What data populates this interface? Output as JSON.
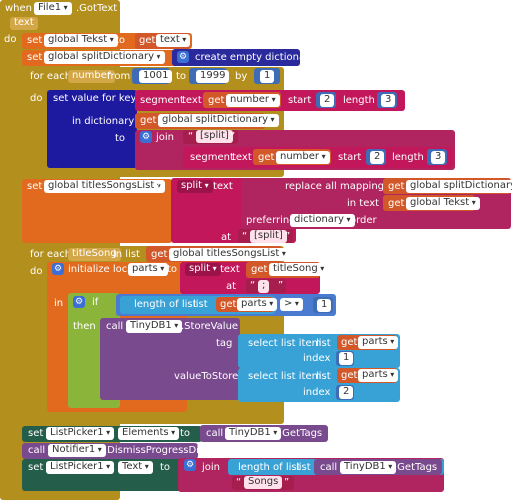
{
  "event": {
    "when": "when",
    "component": "File1",
    "event_name": ".GotText",
    "param": "text",
    "do": "do"
  },
  "set1": {
    "set": "set",
    "var": "global Tekst",
    "to": "to",
    "get": "get",
    "get_var": "text"
  },
  "set2": {
    "set": "set",
    "var": "global splitDictionary",
    "to": "to",
    "create": "create empty dictionary"
  },
  "foreach1": {
    "for_each": "for each",
    "var": "number",
    "from": "from",
    "from_val": "1001",
    "to": "to",
    "to_val": "1999",
    "by": "by",
    "by_val": "1",
    "do": "do"
  },
  "setvalue": {
    "label": "set value for key",
    "segment": "segment",
    "text": "text",
    "get": "get",
    "get_var": "number",
    "start": "start",
    "start_val": "2",
    "length": "length",
    "length_val": "3",
    "in_dictionary": "in dictionary",
    "dict_get": "get",
    "dict_var": "global splitDictionary",
    "to": "to",
    "join": "join",
    "split_str": "[split]",
    "segment2": "segment",
    "text2": "text",
    "get2": "get",
    "get_var2": "number",
    "start2": "start",
    "start_val2": "2",
    "length2": "length",
    "length_val2": "3"
  },
  "set3": {
    "set": "set",
    "var": "global titlesSongsList",
    "to": "to",
    "split": "split",
    "text": "text",
    "replace": "replace all mappings",
    "get1": "get",
    "var1": "global splitDictionary",
    "in_text": "in text",
    "get2": "get",
    "var2": "global Tekst",
    "preferring": "preferring",
    "pref_val": "dictionary",
    "order": "order",
    "at": "at",
    "at_val": "[split]"
  },
  "foreach2": {
    "for_each": "for each",
    "var": "titleSong",
    "in_list": "in list",
    "get": "get",
    "list_var": "global titlesSongsList",
    "do": "do"
  },
  "init": {
    "label": "initialize local",
    "var": "parts",
    "to": "to",
    "split": "split",
    "text": "text",
    "get": "get",
    "get_var": "titleSong",
    "at": "at",
    "at_val": ";",
    "in": "in"
  },
  "ifblock": {
    "if": "if",
    "length_of_list": "length of list",
    "list": "list",
    "get": "get",
    "get_var": "parts",
    "op": ">",
    "op_val": "1",
    "then": "then"
  },
  "store": {
    "call": "call",
    "component": "TinyDB1",
    "method": ".StoreValue",
    "tag": "tag",
    "select1": "select list item",
    "list1": "list",
    "get1": "get",
    "var1": "parts",
    "index1": "index",
    "index_val1": "1",
    "valueToStore": "valueToStore",
    "select2": "select list item",
    "list2": "list",
    "get2": "get",
    "var2": "parts",
    "index2": "index",
    "index_val2": "2"
  },
  "set4": {
    "set": "set",
    "component": "ListPicker1",
    "prop": "Elements",
    "to": "to",
    "call": "call",
    "call_comp": "TinyDB1",
    "method": ".GetTags"
  },
  "call2": {
    "call": "call",
    "component": "Notifier1",
    "method": ".DismissProgressDialog"
  },
  "set5": {
    "set": "set",
    "component": "ListPicker1",
    "prop": "Text",
    "to": "to",
    "join": "join",
    "length_of_list": "length of list",
    "list": "list",
    "call": "call",
    "call_comp": "TinyDB1",
    "method": ".GetTags",
    "songs": "Songs"
  }
}
